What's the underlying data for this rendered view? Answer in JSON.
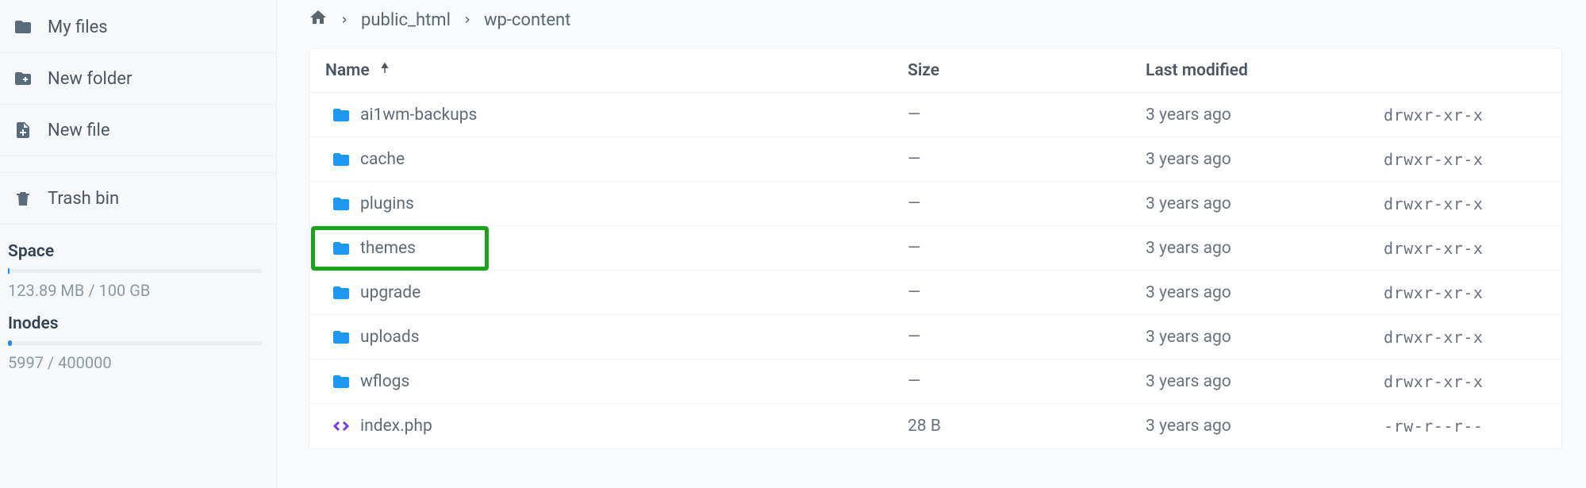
{
  "sidebar": {
    "items": [
      {
        "label": "My files",
        "icon": "folder-icon"
      },
      {
        "label": "New folder",
        "icon": "new-folder-icon"
      },
      {
        "label": "New file",
        "icon": "new-file-icon"
      },
      {
        "label": "Trash bin",
        "icon": "trash-icon"
      }
    ],
    "space": {
      "label": "Space",
      "value": "123.89 MB / 100 GB",
      "percent": 0.5
    },
    "inodes": {
      "label": "Inodes",
      "value": "5997 / 400000",
      "percent": 1.5
    }
  },
  "breadcrumb": {
    "items": [
      "public_html",
      "wp-content"
    ]
  },
  "table": {
    "headers": {
      "name": "Name",
      "size": "Size",
      "modified": "Last modified"
    },
    "rows": [
      {
        "type": "folder",
        "name": "ai1wm-backups",
        "size": "—",
        "modified": "3 years ago",
        "perm": "drwxr-xr-x",
        "highlight": false
      },
      {
        "type": "folder",
        "name": "cache",
        "size": "—",
        "modified": "3 years ago",
        "perm": "drwxr-xr-x",
        "highlight": false
      },
      {
        "type": "folder",
        "name": "plugins",
        "size": "—",
        "modified": "3 years ago",
        "perm": "drwxr-xr-x",
        "highlight": false
      },
      {
        "type": "folder",
        "name": "themes",
        "size": "—",
        "modified": "3 years ago",
        "perm": "drwxr-xr-x",
        "highlight": true
      },
      {
        "type": "folder",
        "name": "upgrade",
        "size": "—",
        "modified": "3 years ago",
        "perm": "drwxr-xr-x",
        "highlight": false
      },
      {
        "type": "folder",
        "name": "uploads",
        "size": "—",
        "modified": "3 years ago",
        "perm": "drwxr-xr-x",
        "highlight": false
      },
      {
        "type": "folder",
        "name": "wflogs",
        "size": "—",
        "modified": "3 years ago",
        "perm": "drwxr-xr-x",
        "highlight": false
      },
      {
        "type": "file",
        "name": "index.php",
        "size": "28 B",
        "modified": "3 years ago",
        "perm": "-rw-r--r--",
        "highlight": false
      }
    ]
  }
}
